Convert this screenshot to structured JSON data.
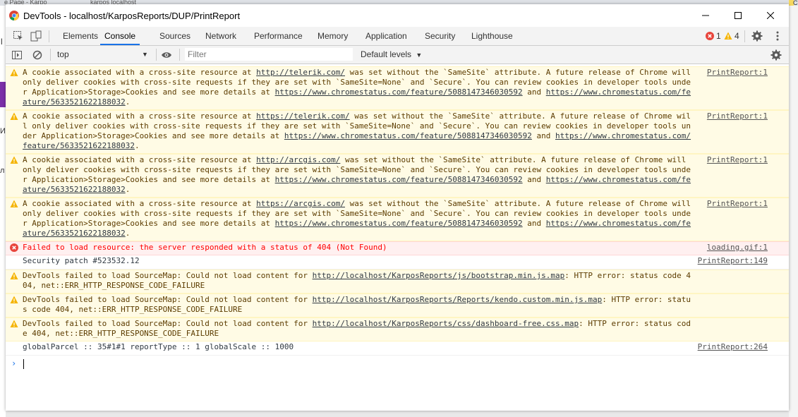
{
  "background": {
    "tab1": "e Page - Karpo",
    "tab2": "karpos localhost",
    "right_edge_label": "C",
    "left_fragments": [
      "l",
      "И",
      "л"
    ]
  },
  "window": {
    "title": "DevTools - localhost/KarposReports/DUP/PrintReport",
    "controls": [
      "minimize-icon",
      "maximize-icon",
      "close-icon"
    ]
  },
  "tabs": [
    "Elements",
    "Console",
    "Sources",
    "Network",
    "Performance",
    "Memory",
    "Application",
    "Security",
    "Lighthouse"
  ],
  "active_tab": "Console",
  "counts": {
    "errors": "1",
    "warnings": "4"
  },
  "toolbar": {
    "context": "top",
    "filter_placeholder": "Filter",
    "levels": "Default levels"
  },
  "colors": {
    "accent": "#1a73e8",
    "warning_bg": "#fffbe5",
    "error_bg": "#fff0f0",
    "error_text": "#ff0000"
  },
  "messages": [
    {
      "type": "warn",
      "parts": [
        "A cookie associated with a cross-site resource at ",
        "http://telerik.com/",
        " was set without the `SameSite` attribute. A future release of Chrome will only deliver cookies with cross-site requests if they are set with `SameSite=None` and `Secure`. You can review cookies in developer tools under Application>Storage>Cookies and see more details at ",
        "https://www.chromestatus.com/feature/5088147346030592",
        " and ",
        "https://www.chromestatus.com/feature/5633521622188032",
        "."
      ],
      "source": "PrintReport:1"
    },
    {
      "type": "warn",
      "parts": [
        "A cookie associated with a cross-site resource at ",
        "https://telerik.com/",
        " was set without the `SameSite` attribute. A future release of Chrome will only deliver cookies with cross-site requests if they are set with `SameSite=None` and `Secure`. You can review cookies in developer tools under Application>Storage>Cookies and see more details at ",
        "https://www.chromestatus.com/feature/5088147346030592",
        " and ",
        "https://www.chromestatus.com/feature/5633521622188032",
        "."
      ],
      "source": "PrintReport:1"
    },
    {
      "type": "warn",
      "parts": [
        "A cookie associated with a cross-site resource at ",
        "http://arcgis.com/",
        " was set without the `SameSite` attribute. A future release of Chrome will only deliver cookies with cross-site requests if they are set with `SameSite=None` and `Secure`. You can review cookies in developer tools under Application>Storage>Cookies and see more details at ",
        "https://www.chromestatus.com/feature/5088147346030592",
        " and ",
        "https://www.chromestatus.com/feature/5633521622188032",
        "."
      ],
      "source": "PrintReport:1"
    },
    {
      "type": "warn",
      "parts": [
        "A cookie associated with a cross-site resource at ",
        "https://arcgis.com/",
        " was set without the `SameSite` attribute. A future release of Chrome will only deliver cookies with cross-site requests if they are set with `SameSite=None` and `Secure`. You can review cookies in developer tools under Application>Storage>Cookies and see more details at ",
        "https://www.chromestatus.com/feature/5088147346030592",
        " and ",
        "https://www.chromestatus.com/feature/5633521622188032",
        "."
      ],
      "source": "PrintReport:1"
    },
    {
      "type": "error",
      "parts": [
        "Failed to load resource: the server responded with a status of 404 (Not Found)"
      ],
      "source": "loading.gif:1"
    },
    {
      "type": "log",
      "parts": [
        "Security patch #523532.12"
      ],
      "source": "PrintReport:149"
    },
    {
      "type": "warn",
      "parts": [
        "DevTools failed to load SourceMap: Could not load content for ",
        "http://localhost/KarposReports/js/bootstrap.min.js.map",
        ": HTTP error: status code 404, net::ERR_HTTP_RESPONSE_CODE_FAILURE"
      ],
      "source": ""
    },
    {
      "type": "warn",
      "parts": [
        "DevTools failed to load SourceMap: Could not load content for ",
        "http://localhost/KarposReports/Reports/kendo.custom.min.js.map",
        ": HTTP error: status code 404, net::ERR_HTTP_RESPONSE_CODE_FAILURE"
      ],
      "source": ""
    },
    {
      "type": "warn",
      "parts": [
        "DevTools failed to load SourceMap: Could not load content for ",
        "http://localhost/KarposReports/css/dashboard-free.css.map",
        ": HTTP error: status code 404, net::ERR_HTTP_RESPONSE_CODE_FAILURE"
      ],
      "source": ""
    },
    {
      "type": "log",
      "parts": [
        "globalParcel :: 35#1#1 reportType :: 1 globalScale :: 1000"
      ],
      "source": "PrintReport:264"
    }
  ]
}
